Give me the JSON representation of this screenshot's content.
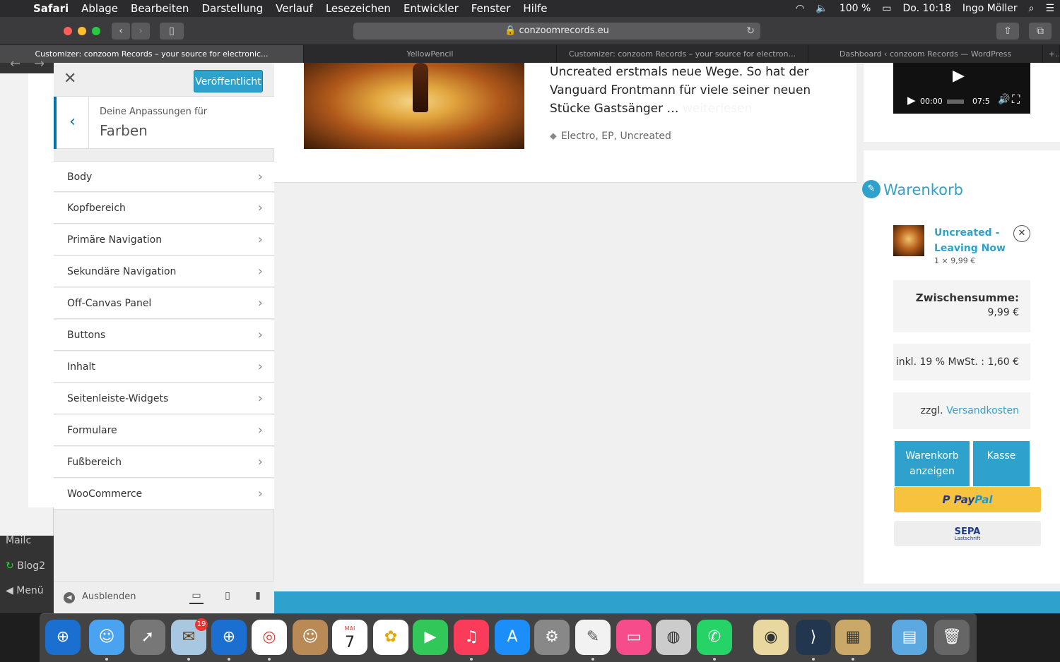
{
  "menubar": {
    "app": "Safari",
    "items": [
      "Ablage",
      "Bearbeiten",
      "Darstellung",
      "Verlauf",
      "Lesezeichen",
      "Entwickler",
      "Fenster",
      "Hilfe"
    ],
    "battery": "100 %",
    "clock": "Do. 10:18",
    "user": "Ingo Möller"
  },
  "browser": {
    "url": "conzoomrecords.eu",
    "tabs": [
      "Customizer: conzoom Records – your source for electronic...",
      "YellowPencil",
      "Customizer: conzoom Records – your source for electron...",
      "Dashboard ‹ conzoom Records — WordPress"
    ]
  },
  "background_window": {
    "items": [
      "Mailc",
      "Blog2",
      "Menü"
    ]
  },
  "customizer": {
    "publish_label": "Veröffentlicht",
    "section_subtitle": "Deine Anpassungen für",
    "section_title": "Farben",
    "items": [
      "Body",
      "Kopfbereich",
      "Primäre Navigation",
      "Sekundäre Navigation",
      "Off-Canvas Panel",
      "Buttons",
      "Inhalt",
      "Seitenleiste-Widgets",
      "Formulare",
      "Fußbereich",
      "WooCommerce"
    ],
    "hide_label": "Ausblenden"
  },
  "post": {
    "excerpt": "Uncreated erstmals neue Wege. So hat der Vanguard Frontmann für viele seiner neuen Stücke Gastsänger …",
    "read_more": "weiterlesen",
    "tags": "Electro, EP, Uncreated"
  },
  "video": {
    "time_current": "00:00",
    "time_total": "07:5"
  },
  "cart": {
    "title": "Warenkorb",
    "product_line1": "Uncreated -",
    "product_line2": "Leaving Now",
    "qty_price": "1 × 9,99 €",
    "subtotal_label": "Zwischensumme:",
    "subtotal_value": "9,99 €",
    "tax": "inkl. 19 % MwSt. : 1,60 €",
    "shipping_prefix": "zzgl.",
    "shipping_link": "Versandkosten",
    "view_cart_line1": "Warenkorb",
    "view_cart_line2": "anzeigen",
    "checkout": "Kasse",
    "paypal_a": "Pay",
    "paypal_b": "Pal",
    "sepa": "SEPA",
    "sepa_sub": "Lastschrift"
  },
  "dock": {
    "badge": "19",
    "calendar_month": "MAI",
    "calendar_day": "7"
  },
  "colors": {
    "accent": "#2ea2cc",
    "paypal": "#f7c23d"
  }
}
